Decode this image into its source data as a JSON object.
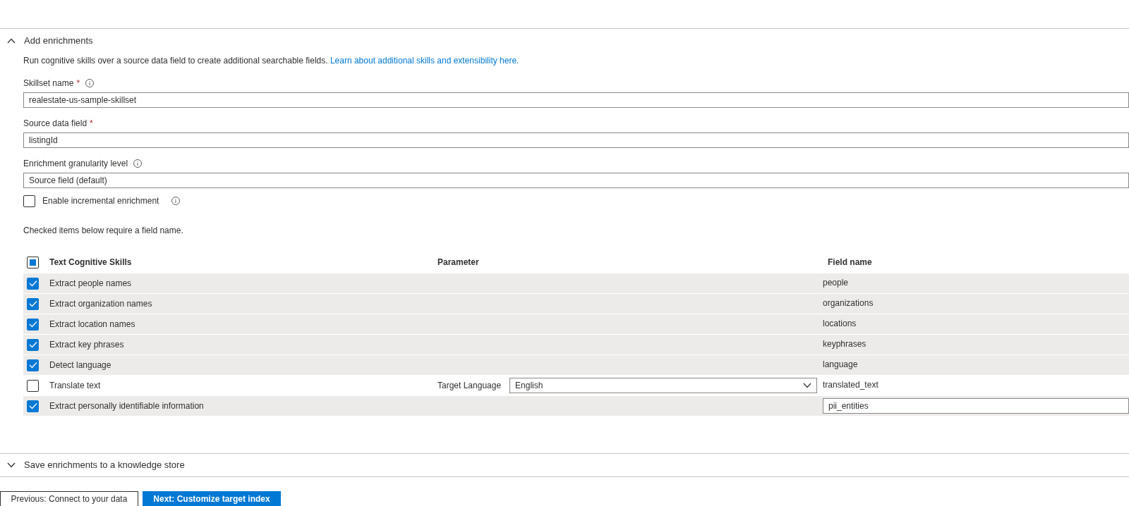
{
  "enrichments": {
    "title": "Add enrichments",
    "expanded": true,
    "description": "Run cognitive skills over a source data field to create additional searchable fields.",
    "link": "Learn about additional skills and extensibility here.",
    "fields": [
      {
        "label": "Skillset name",
        "required_mark": "*",
        "info": true,
        "value": "realestate-us-sample-skillset"
      },
      {
        "label": "Source data field",
        "required_mark": "*",
        "info": false,
        "value": "listingId"
      },
      {
        "label": "Enrichment granularity level",
        "info": true,
        "value": "Source field (default)"
      }
    ],
    "incremental": {
      "label": "Enable incremental enrichment",
      "checked": false
    },
    "note": "Checked items below require a field name.",
    "table": {
      "columns": [
        "Text Cognitive Skills",
        "Parameter",
        "Field name"
      ],
      "header_indeterminate": true,
      "rows": [
        {
          "skill": "Extract people names",
          "checked": true,
          "kind": "text",
          "field": "people"
        },
        {
          "skill": "Extract organization names",
          "checked": true,
          "kind": "text",
          "field": "organizations"
        },
        {
          "skill": "Extract location names",
          "checked": true,
          "kind": "text",
          "field": "locations"
        },
        {
          "skill": "Extract key phrases",
          "checked": true,
          "kind": "text",
          "field": "keyphrases"
        },
        {
          "skill": "Detect language",
          "checked": true,
          "kind": "text",
          "field": "language"
        },
        {
          "skill": "Translate text",
          "checked": false,
          "parameter": {
            "label": "Target Language",
            "value": "English"
          },
          "kind": "text",
          "field": "translated_text"
        },
        {
          "skill": "Extract personally identifiable information",
          "checked": true,
          "kind": "input",
          "field": "pii_entities"
        }
      ]
    }
  },
  "knowledge_store": {
    "title": "Save enrichments to a knowledge store",
    "expanded": false
  },
  "buttons": [
    {
      "label": "Previous: Connect to your data",
      "kind": "secondary"
    },
    {
      "label": "Next: Customize target index",
      "kind": "primary"
    }
  ]
}
